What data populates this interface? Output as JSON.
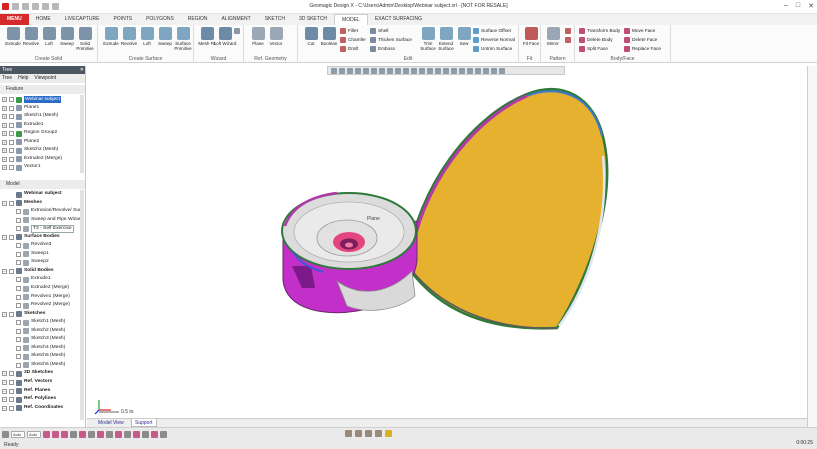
{
  "window": {
    "title": "Geomagic Design X - C:\\Users\\Admin\\Desktop\\Webinar subject.xrl - [NOT FOR RESALE]",
    "controls": [
      "–",
      "□",
      "✕"
    ]
  },
  "menubar": {
    "tabs": [
      "MENU",
      "HOME",
      "LIVECAPTURE",
      "POINTS",
      "POLYGONS",
      "REGION",
      "ALIGNMENT",
      "SKETCH",
      "3D SKETCH",
      "MODEL",
      "EXACT SURFACING"
    ],
    "active": "MODEL"
  },
  "ribbon": {
    "groups": {
      "create_solid": "Create Solid",
      "create_surface": "Create Surface",
      "wizard": "Wizard",
      "ref_geometry": "Ref. Geometry",
      "edit": "Edit",
      "fit": "Fit",
      "pattern": "Pattern",
      "body_face": "Body/Face"
    },
    "buttons": {
      "extrude": "Extrude",
      "revolve": "Revolve",
      "loft": "Loft",
      "sweep": "Sweep",
      "solid_primitive": "Solid Primitive",
      "extrude2": "Extrude",
      "revolve2": "Revolve",
      "loft2": "Loft",
      "sweep2": "Sweep",
      "surface_primitive": "Surface Primitive",
      "mesh_fit": "Mesh Fit",
      "loft_wizard": "Loft Wizard",
      "plane": "Plane",
      "vector": "Vector",
      "cut": "Cut",
      "boolean": "Boolean",
      "fillet": "Fillet",
      "chamfer": "Chamfer",
      "draft": "Draft",
      "shell": "Shell",
      "thicken_surface": "Thicken Surface",
      "emboss": "Emboss",
      "trim_surface": "Trim Surface",
      "extend_surface": "Extend Surface",
      "sew": "Sew",
      "surface_offset": "Surface Offset",
      "reverse_normal": "Reverse Normal",
      "untrim_surface": "Untrim Surface",
      "fit_face": "Fit Face",
      "mirror": "Mirror",
      "transform_body": "Transform Body",
      "delete_body": "Delete Body",
      "split_face": "Split Face",
      "move_face": "Move Face",
      "delete_face": "Delete Face",
      "replace_face": "Replace Face"
    }
  },
  "sidebar": {
    "panel_title": "Tree",
    "tabs": [
      "Tree",
      "Help",
      "Viewpoint"
    ],
    "feature_header": "Feature",
    "feature_tree": [
      {
        "label": "Webinar subject",
        "selected": true
      },
      {
        "label": "Plane1"
      },
      {
        "label": "Sketch1 (Mesh)"
      },
      {
        "label": "Extrude1"
      },
      {
        "label": "Region Group2"
      },
      {
        "label": "Plane2"
      },
      {
        "label": "Sketch2 (Mesh)"
      },
      {
        "label": "Extrude2 (Merge)"
      },
      {
        "label": "Vector1"
      }
    ],
    "model_header": "Model",
    "model_tree": [
      {
        "label": "Webinar subject",
        "bold": true,
        "level": 0
      },
      {
        "label": "Meshes",
        "bold": true,
        "level": 0
      },
      {
        "label": "Extrusion/Revolve/ Surf",
        "level": 1
      },
      {
        "label": "Sweep and Pipe Wizard",
        "level": 1
      },
      {
        "label": "T3 - Self Exercise",
        "level": 1,
        "boxed": true
      },
      {
        "label": "Surface Bodies",
        "bold": true,
        "level": 0
      },
      {
        "label": "Revolve3",
        "level": 1
      },
      {
        "label": "Sweep1",
        "level": 1
      },
      {
        "label": "Sweep2",
        "level": 1
      },
      {
        "label": "Solid Bodies",
        "bold": true,
        "level": 0
      },
      {
        "label": "Extrude1",
        "level": 1
      },
      {
        "label": "Extrude2 (Merge)",
        "level": 1
      },
      {
        "label": "Revolve1 (Merge)",
        "level": 1
      },
      {
        "label": "Revolve2 (Merge)",
        "level": 1
      },
      {
        "label": "Sketches",
        "bold": true,
        "level": 0
      },
      {
        "label": "Sketch1 (Mesh)",
        "level": 1
      },
      {
        "label": "Sketch2 (Mesh)",
        "level": 1
      },
      {
        "label": "Sketch3 (Mesh)",
        "level": 1
      },
      {
        "label": "Sketch4 (Mesh)",
        "level": 1
      },
      {
        "label": "Sketch5 (Mesh)",
        "level": 1
      },
      {
        "label": "Sketch6 (Mesh)",
        "level": 1
      },
      {
        "label": "3D Sketches",
        "bold": true,
        "level": 0
      },
      {
        "label": "Ref. Vectors",
        "bold": true,
        "level": 0
      },
      {
        "label": "Ref. Planes",
        "bold": true,
        "level": 0
      },
      {
        "label": "Ref. Polylines",
        "bold": true,
        "level": 0
      },
      {
        "label": "Ref. Coordinates",
        "bold": true,
        "level": 0
      }
    ]
  },
  "viewport": {
    "plane_label": "Plane",
    "scale_label": "0.5 in."
  },
  "model_tabs": [
    "Model View",
    "Support"
  ],
  "status": {
    "ready": "Ready",
    "select_auto1": "Auto",
    "select_auto2": "Auto",
    "time": "0:00:25"
  },
  "colors": {
    "menu_red": "#d42a2a",
    "cone_yellow": "#e6b12e",
    "body_magenta": "#c22fc9",
    "panel_header": "#4c5663",
    "selection_blue": "#2c6cc8"
  }
}
